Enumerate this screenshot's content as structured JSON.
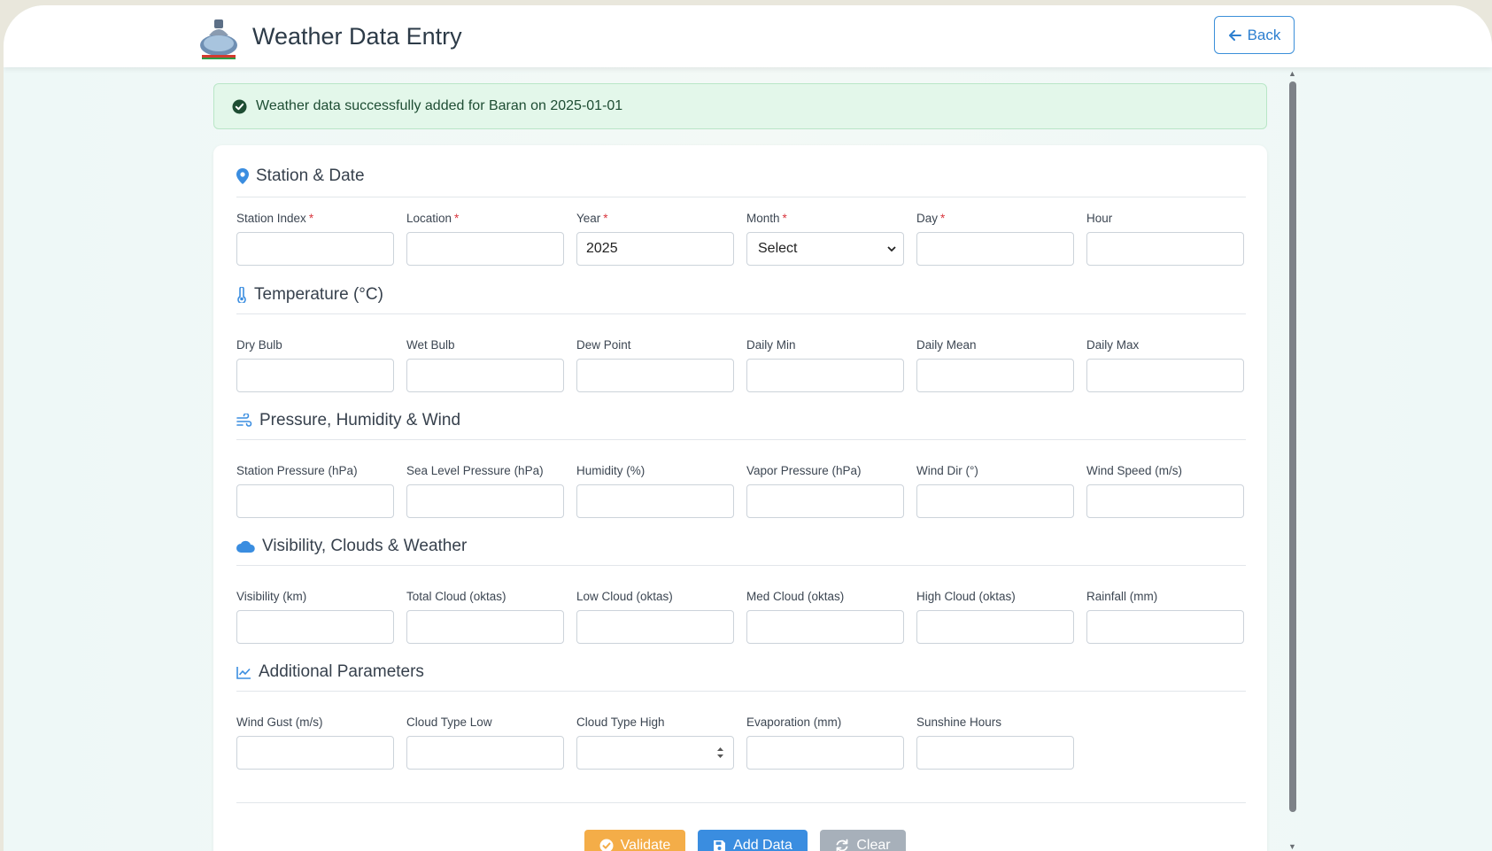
{
  "header": {
    "title": "Weather Data Entry",
    "back_label": "Back"
  },
  "alert": {
    "message": "Weather data successfully added for Baran on 2025-01-01"
  },
  "sections": {
    "station": {
      "title": "Station & Date",
      "fields": {
        "station_index": "Station Index",
        "location": "Location",
        "year": "Year",
        "year_value": "2025",
        "month": "Month",
        "month_selected": "Select",
        "day": "Day",
        "hour": "Hour",
        "required_mark": "*"
      }
    },
    "temperature": {
      "title": "Temperature (°C)",
      "fields": [
        "Dry Bulb",
        "Wet Bulb",
        "Dew Point",
        "Daily Min",
        "Daily Mean",
        "Daily Max"
      ]
    },
    "pressure": {
      "title": "Pressure, Humidity & Wind",
      "fields": [
        "Station Pressure (hPa)",
        "Sea Level Pressure (hPa)",
        "Humidity (%)",
        "Vapor Pressure (hPa)",
        "Wind Dir (°)",
        "Wind Speed (m/s)"
      ]
    },
    "visibility": {
      "title": "Visibility, Clouds & Weather",
      "fields": [
        "Visibility (km)",
        "Total Cloud (oktas)",
        "Low Cloud (oktas)",
        "Med Cloud (oktas)",
        "High Cloud (oktas)",
        "Rainfall (mm)"
      ]
    },
    "additional": {
      "title": "Additional Parameters",
      "fields": [
        "Wind Gust (m/s)",
        "Cloud Type Low",
        "Cloud Type High",
        "Evaporation (mm)",
        "Sunshine Hours"
      ]
    }
  },
  "buttons": {
    "validate": "Validate",
    "add": "Add Data",
    "clear": "Clear"
  },
  "icons": {
    "logo": "emblem-logo",
    "back": "arrow-left-icon",
    "alert": "check-circle-icon",
    "station": "map-pin-icon",
    "temperature": "thermometer-icon",
    "pressure": "wind-icon",
    "visibility": "cloud-icon",
    "additional": "line-chart-icon"
  },
  "colors": {
    "accent": "#3a8de0",
    "validate": "#f4ad48",
    "clear": "#a7b0ba",
    "success_bg": "#e3f7ea",
    "required": "#d9363e"
  }
}
